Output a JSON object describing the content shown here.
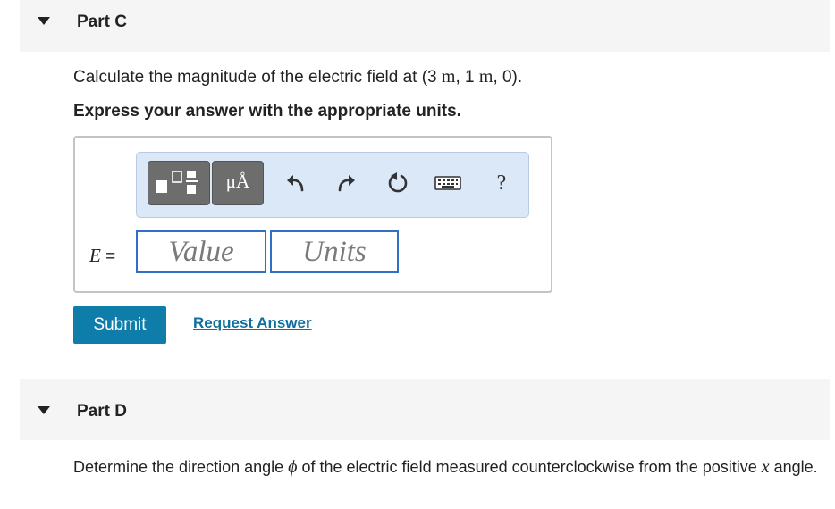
{
  "part_c": {
    "title": "Part C",
    "question_prefix": "Calculate the magnitude of the electric field at (3 ",
    "unit_m": "m",
    "question_mid": ", 1 ",
    "question_suffix": ", 0).",
    "instruction": "Express your answer with the appropriate units.",
    "toolbar": {
      "units_label": "μÅ",
      "help_label": "?"
    },
    "equation_var": "E",
    "equation_eq": " =",
    "value_placeholder": "Value",
    "units_placeholder": "Units",
    "submit_label": "Submit",
    "request_answer_label": "Request Answer"
  },
  "part_d": {
    "title": "Part D",
    "text_prefix": "Determine the direction angle ",
    "phi": "ϕ",
    "text_mid": " of the electric field measured counterclockwise from the positive ",
    "x_var": "x",
    "text_suffix": " angle."
  },
  "colors": {
    "accent": "#0f7daa",
    "input_border": "#2f6fc4",
    "toolbar_bg": "#dbe8f8"
  },
  "icons": [
    "caret-down-icon",
    "templates-icon",
    "units-icon",
    "undo-icon",
    "redo-icon",
    "reset-icon",
    "keyboard-icon",
    "help-icon"
  ]
}
